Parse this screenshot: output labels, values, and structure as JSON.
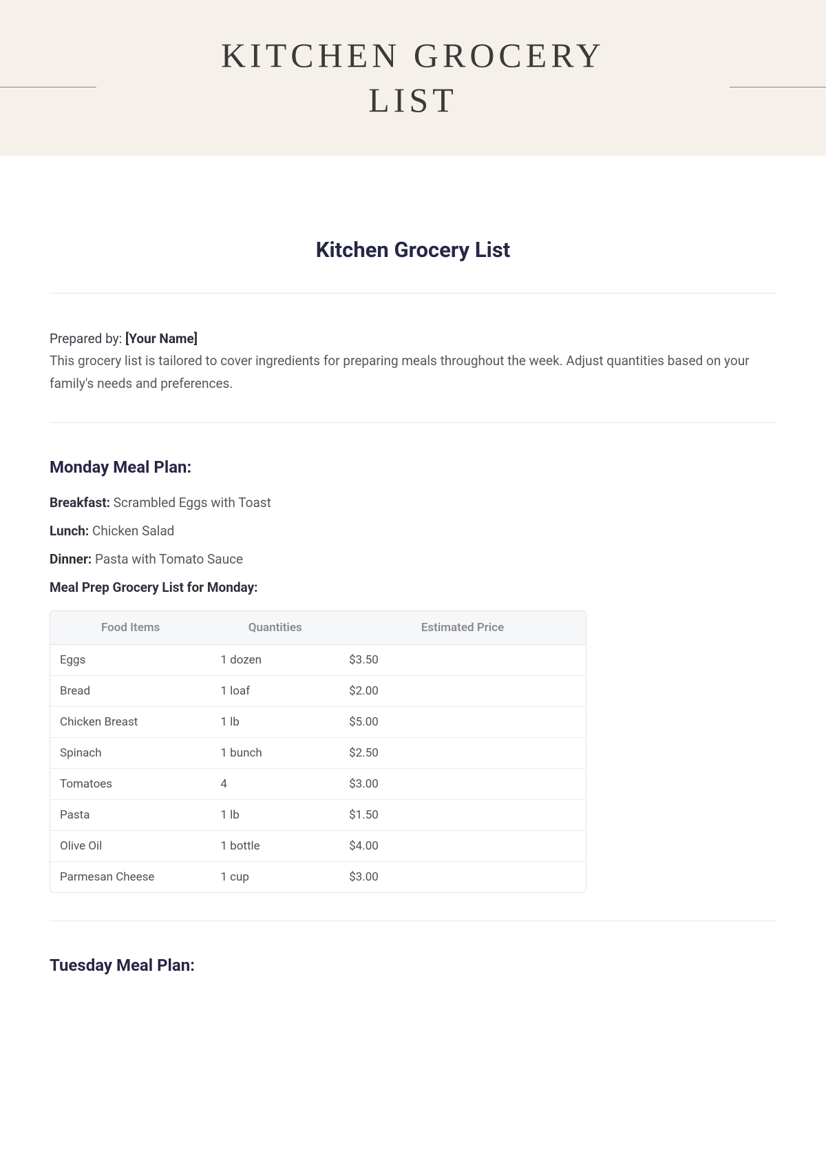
{
  "banner": {
    "title_line1": "KITCHEN GROCERY",
    "title_line2": "LIST"
  },
  "doc_title": "Kitchen Grocery List",
  "intro": {
    "prepared_label": "Prepared by: ",
    "prepared_name": "[Your Name]",
    "blurb": "This grocery list is tailored to cover ingredients for preparing meals throughout the week. Adjust quantities based on your family's needs and preferences."
  },
  "monday": {
    "heading": "Monday Meal Plan:",
    "breakfast_label": "Breakfast:",
    "breakfast_value": " Scrambled Eggs with Toast",
    "lunch_label": "Lunch:",
    "lunch_value": " Chicken Salad",
    "dinner_label": "Dinner:",
    "dinner_value": " Pasta with Tomato Sauce",
    "subhead": "Meal Prep Grocery List for Monday:",
    "table": {
      "headers": {
        "item": "Food Items",
        "qty": "Quantities",
        "price": "Estimated Price"
      },
      "rows": [
        {
          "item": "Eggs",
          "qty": "1 dozen",
          "price": "$3.50"
        },
        {
          "item": "Bread",
          "qty": "1 loaf",
          "price": "$2.00"
        },
        {
          "item": "Chicken Breast",
          "qty": "1 lb",
          "price": "$5.00"
        },
        {
          "item": "Spinach",
          "qty": "1 bunch",
          "price": "$2.50"
        },
        {
          "item": "Tomatoes",
          "qty": "4",
          "price": "$3.00"
        },
        {
          "item": "Pasta",
          "qty": "1 lb",
          "price": "$1.50"
        },
        {
          "item": "Olive Oil",
          "qty": "1 bottle",
          "price": "$4.00"
        },
        {
          "item": "Parmesan Cheese",
          "qty": "1 cup",
          "price": "$3.00"
        }
      ]
    }
  },
  "tuesday": {
    "heading": "Tuesday Meal Plan:"
  }
}
